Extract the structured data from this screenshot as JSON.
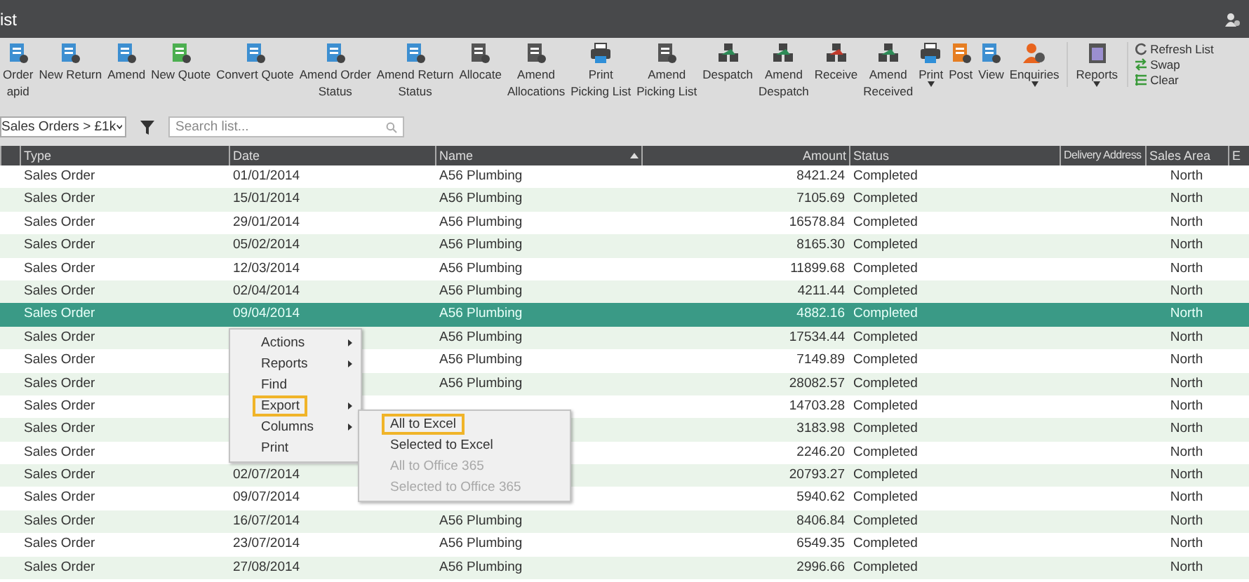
{
  "window": {
    "title": "ist"
  },
  "toolbar": [
    {
      "lines": [
        "Order",
        "apid"
      ],
      "kind": "doc"
    },
    {
      "lines": [
        "New Return"
      ],
      "kind": "doc"
    },
    {
      "lines": [
        "Amend"
      ],
      "kind": "doc"
    },
    {
      "lines": [
        "New Quote"
      ],
      "kind": "doc"
    },
    {
      "lines": [
        "Convert Quote"
      ],
      "kind": "doc"
    },
    {
      "lines": [
        "Amend Order",
        "Status"
      ],
      "kind": "doc"
    },
    {
      "lines": [
        "Amend Return",
        "Status"
      ],
      "kind": "doc"
    },
    {
      "lines": [
        "Allocate"
      ],
      "kind": "doc"
    },
    {
      "lines": [
        "Amend",
        "Allocations"
      ],
      "kind": "doc"
    },
    {
      "lines": [
        "Print",
        "Picking List"
      ],
      "kind": "printer"
    },
    {
      "lines": [
        "Amend",
        "Picking List"
      ],
      "kind": "doc"
    },
    {
      "lines": [
        "Despatch"
      ],
      "kind": "boxes"
    },
    {
      "lines": [
        "Amend",
        "Despatch"
      ],
      "kind": "boxes"
    },
    {
      "lines": [
        "Receive"
      ],
      "kind": "boxes"
    },
    {
      "lines": [
        "Amend",
        "Received"
      ],
      "kind": "boxes"
    },
    {
      "lines": [
        "Print"
      ],
      "kind": "printer",
      "dropdown": true
    },
    {
      "lines": [
        "Post"
      ],
      "kind": "doc"
    },
    {
      "lines": [
        "View"
      ],
      "kind": "doc"
    },
    {
      "lines": [
        "Enquiries"
      ],
      "kind": "person",
      "dropdown": true
    },
    {
      "lines": [
        "Reports"
      ],
      "kind": "report",
      "dropdown": true
    }
  ],
  "side_actions": [
    {
      "label": "Refresh List",
      "kind": "refresh"
    },
    {
      "label": "Swap",
      "kind": "swap"
    },
    {
      "label": "Clear",
      "kind": "clear"
    }
  ],
  "filter": {
    "view": "Sales Orders > £1k",
    "search_placeholder": "Search list..."
  },
  "table": {
    "columns": [
      {},
      {
        "label": "Type"
      },
      {
        "label": "Date"
      },
      {
        "label": "Name",
        "sorted": true
      },
      {
        "label": "Amount"
      },
      {
        "label": "Status"
      },
      {
        "label": "Delivery Address"
      },
      {
        "label": "Sales Area"
      },
      {
        "label": "E"
      }
    ],
    "rows": [
      {
        "type": "Sales Order",
        "date": "01/01/2014",
        "name": "A56 Plumbing",
        "amount": "8421.24",
        "status": "Completed",
        "area": "North",
        "selected": false
      },
      {
        "type": "Sales Order",
        "date": "15/01/2014",
        "name": "A56 Plumbing",
        "amount": "7105.69",
        "status": "Completed",
        "area": "North",
        "selected": false
      },
      {
        "type": "Sales Order",
        "date": "29/01/2014",
        "name": "A56 Plumbing",
        "amount": "16578.84",
        "status": "Completed",
        "area": "North",
        "selected": false
      },
      {
        "type": "Sales Order",
        "date": "05/02/2014",
        "name": "A56 Plumbing",
        "amount": "8165.30",
        "status": "Completed",
        "area": "North",
        "selected": false
      },
      {
        "type": "Sales Order",
        "date": "12/03/2014",
        "name": "A56 Plumbing",
        "amount": "11899.68",
        "status": "Completed",
        "area": "North",
        "selected": false
      },
      {
        "type": "Sales Order",
        "date": "02/04/2014",
        "name": "A56 Plumbing",
        "amount": "4211.44",
        "status": "Completed",
        "area": "North",
        "selected": false
      },
      {
        "type": "Sales Order",
        "date": "09/04/2014",
        "name": "A56 Plumbing",
        "amount": "4882.16",
        "status": "Completed",
        "area": "North",
        "selected": true
      },
      {
        "type": "Sales Order",
        "name": "A56 Plumbing",
        "amount": "17534.44",
        "status": "Completed",
        "area": "North",
        "selected": false
      },
      {
        "type": "Sales Order",
        "name": "A56 Plumbing",
        "amount": "7149.89",
        "status": "Completed",
        "area": "North",
        "selected": false
      },
      {
        "type": "Sales Order",
        "name": "A56 Plumbing",
        "amount": "28082.57",
        "status": "Completed",
        "area": "North",
        "selected": false
      },
      {
        "type": "Sales Order",
        "amount": "14703.28",
        "status": "Completed",
        "area": "North",
        "selected": false
      },
      {
        "type": "Sales Order",
        "amount": "3183.98",
        "status": "Completed",
        "area": "North",
        "selected": false
      },
      {
        "type": "Sales Order",
        "amount": "2246.20",
        "status": "Completed",
        "area": "North",
        "selected": false
      },
      {
        "type": "Sales Order",
        "date": "02/07/2014",
        "amount": "20793.27",
        "status": "Completed",
        "area": "North",
        "selected": false
      },
      {
        "type": "Sales Order",
        "date": "09/07/2014",
        "amount": "5940.62",
        "status": "Completed",
        "area": "North",
        "selected": false
      },
      {
        "type": "Sales Order",
        "date": "16/07/2014",
        "name": "A56 Plumbing",
        "amount": "8406.84",
        "status": "Completed",
        "area": "North",
        "selected": false
      },
      {
        "type": "Sales Order",
        "date": "23/07/2014",
        "name": "A56 Plumbing",
        "amount": "6549.35",
        "status": "Completed",
        "area": "North",
        "selected": false
      },
      {
        "type": "Sales Order",
        "date": "27/08/2014",
        "name": "A56 Plumbing",
        "amount": "2996.66",
        "status": "Completed",
        "area": "North",
        "selected": false
      }
    ]
  },
  "context_menu": {
    "items": [
      {
        "label": "Actions",
        "submenu": true,
        "selected": false
      },
      {
        "label": "Reports",
        "submenu": true,
        "selected": false
      },
      {
        "label": "Find",
        "submenu": false,
        "selected": false
      },
      {
        "label": "Export",
        "submenu": true,
        "selected": true
      },
      {
        "label": "Columns",
        "submenu": true,
        "selected": false
      },
      {
        "label": "Print",
        "submenu": false,
        "selected": false
      }
    ],
    "submenu": [
      {
        "label": "All to Excel",
        "selected": true,
        "disabled": false
      },
      {
        "label": "Selected to Excel",
        "selected": false,
        "disabled": false
      },
      {
        "label": "All to Office 365",
        "selected": false,
        "disabled": true
      },
      {
        "label": "Selected to Office 365",
        "selected": false,
        "disabled": true
      }
    ]
  }
}
